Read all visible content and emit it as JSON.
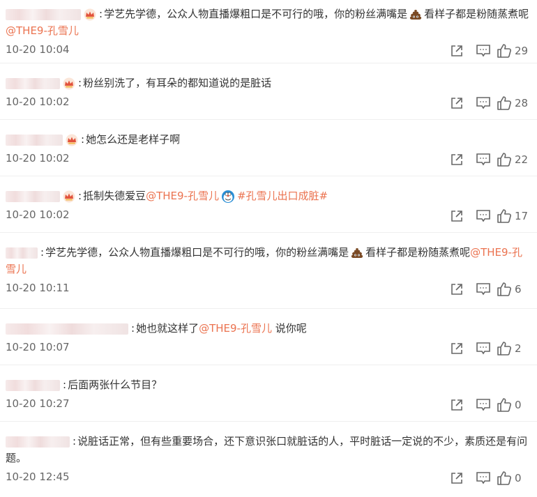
{
  "comments": [
    {
      "colon": ":",
      "texts": [
        "学艺先学德，公众人物直播爆粗口是不可行的哦，你的粉丝满嘴是",
        "看样子都是粉随蒸煮呢"
      ],
      "mention": "@THE9-孔雪儿",
      "timestamp": "10-20 10:04",
      "likes": "29"
    },
    {
      "colon": ":",
      "text": "粉丝别洗了，有耳朵的都知道说的是脏话",
      "timestamp": "10-20 10:02",
      "likes": "28"
    },
    {
      "colon": ":",
      "text": "她怎么还是老样子啊",
      "timestamp": "10-20 10:02",
      "likes": "22"
    },
    {
      "colon": ":",
      "text": "抵制失德爱豆",
      "mention": "@THE9-孔雪儿",
      "hashtag": "#孔雪儿出口成脏#",
      "timestamp": "10-20 10:02",
      "likes": "17"
    },
    {
      "colon": ":",
      "texts": [
        "学艺先学德，公众人物直播爆粗口是不可行的哦，你的粉丝满嘴是",
        "看样子都是粉随蒸煮呢"
      ],
      "mention": "@THE9-孔雪儿",
      "timestamp": "10-20 10:11",
      "likes": "6"
    },
    {
      "colon": ":",
      "text_before": "她也就这样了",
      "mention": "@THE9-孔雪儿",
      "text_after": " 说你呢",
      "timestamp": "10-20 10:07",
      "likes": "2"
    },
    {
      "colon": ":",
      "text": "后面两张什么节目？",
      "timestamp": "10-20 10:27",
      "likes": "0"
    },
    {
      "colon": ":",
      "text": "说脏话正常，但有些重要场合，还下意识张口就脏话的人，平时脏话一定说的不少，素质还是有问题。",
      "timestamp": "10-20 12:45",
      "likes": "0"
    }
  ],
  "icons": {
    "share": "share-icon",
    "comment": "comment-icon",
    "like": "like-icon",
    "crown": "crown-icon",
    "poop": "poop-icon",
    "doraemon": "doraemon-icon"
  },
  "colors": {
    "mention": "#eb7350",
    "timestamp": "#666666",
    "text": "#333333",
    "icon": "#666666"
  }
}
